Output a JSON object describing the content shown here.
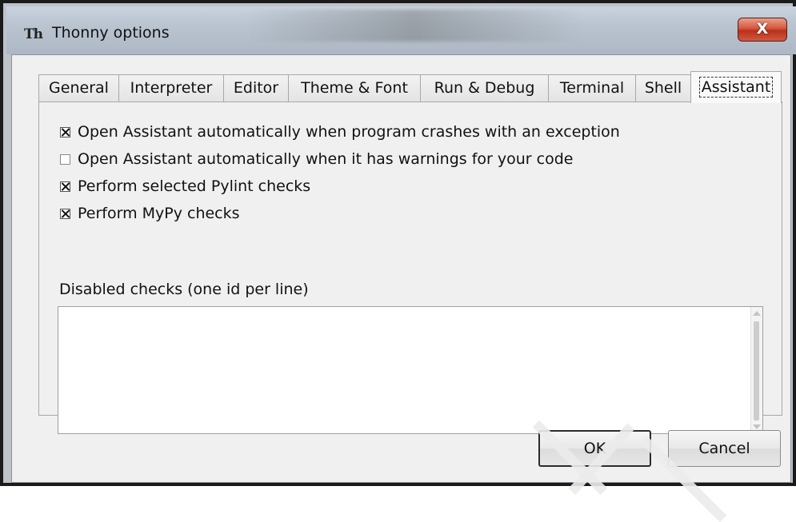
{
  "window": {
    "title": "Thonny options",
    "app_icon": "Th",
    "close_label": "X"
  },
  "tabs": [
    {
      "label": "General",
      "active": false
    },
    {
      "label": "Interpreter",
      "active": false
    },
    {
      "label": "Editor",
      "active": false
    },
    {
      "label": "Theme & Font",
      "active": false
    },
    {
      "label": "Run & Debug",
      "active": false
    },
    {
      "label": "Terminal",
      "active": false
    },
    {
      "label": "Shell",
      "active": false
    },
    {
      "label": "Assistant",
      "active": true
    }
  ],
  "assistant": {
    "options": [
      {
        "label": "Open Assistant automatically when program crashes with an exception",
        "checked": true
      },
      {
        "label": "Open Assistant automatically when it has warnings for your code",
        "checked": false
      },
      {
        "label": "Perform selected Pylint checks",
        "checked": true
      },
      {
        "label": "Perform MyPy checks",
        "checked": true
      }
    ],
    "disabled_checks_label": "Disabled checks (one id per line)",
    "disabled_checks_value": ""
  },
  "buttons": {
    "ok": "OK",
    "cancel": "Cancel"
  }
}
